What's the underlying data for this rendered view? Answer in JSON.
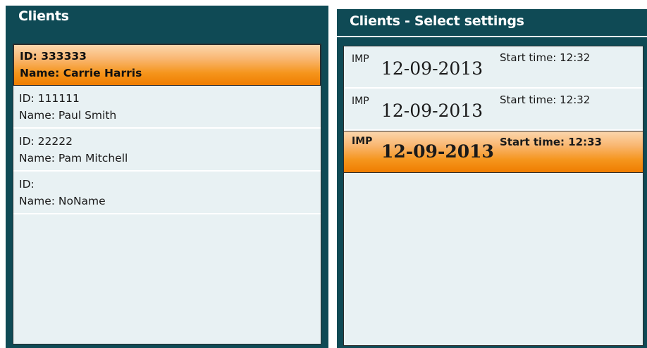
{
  "clients_panel": {
    "title": "Clients",
    "clients": [
      {
        "id": "ID: 333333",
        "name": "Name: Carrie Harris",
        "selected": true
      },
      {
        "id": "ID: 111111",
        "name": "Name: Paul Smith",
        "selected": false
      },
      {
        "id": "ID: 22222",
        "name": "Name: Pam Mitchell",
        "selected": false
      },
      {
        "id": "ID:",
        "name": "Name: NoName",
        "selected": false
      }
    ]
  },
  "sessions_panel": {
    "title": "Clients - Select settings",
    "sessions": [
      {
        "type": "IMP",
        "date": "12-09-2013",
        "start": "Start time: 12:32",
        "selected": false
      },
      {
        "type": "IMP",
        "date": "12-09-2013",
        "start": "Start time: 12:32",
        "selected": false
      },
      {
        "type": "IMP",
        "date": "12-09-2013",
        "start": "Start time: 12:33",
        "selected": true
      }
    ]
  },
  "colors": {
    "panel_bg": "#0f4a55",
    "list_bg": "#e8f1f3",
    "selection_orange": "#f5951c"
  }
}
